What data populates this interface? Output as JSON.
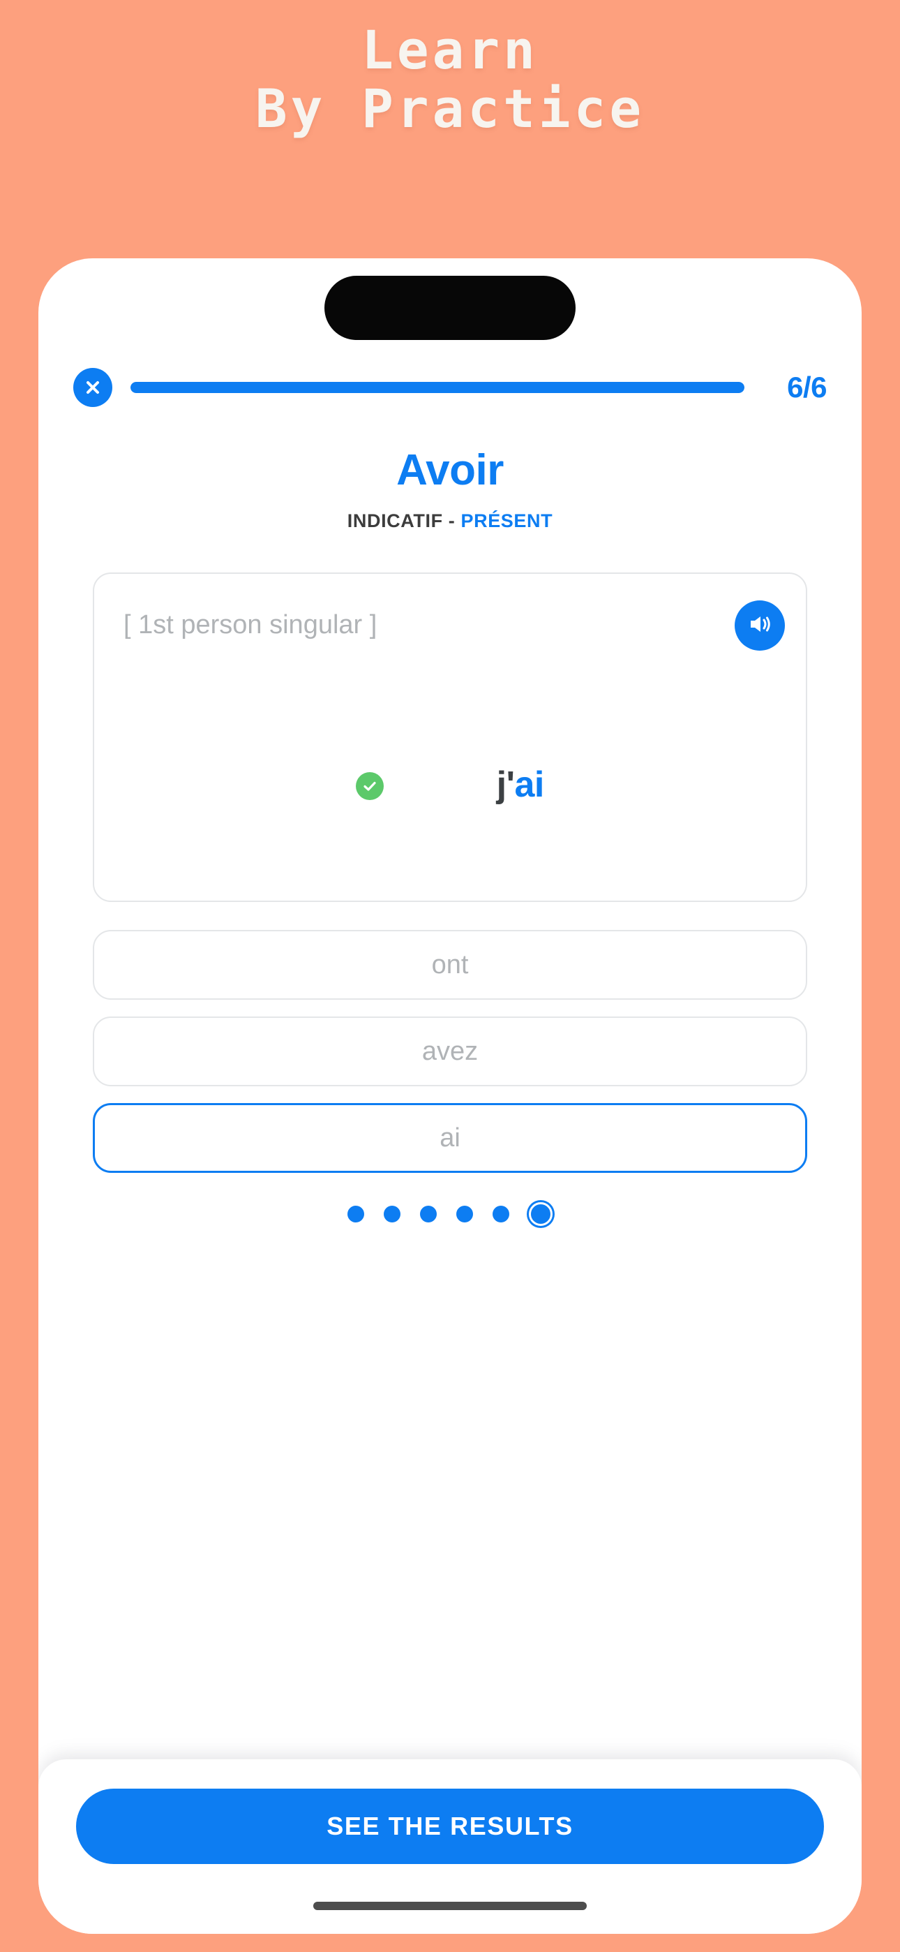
{
  "promo": {
    "line1": "Learn",
    "line2": "By Practice",
    "text_color": "#F7F4EF",
    "background_color": "#FDA07E"
  },
  "theme": {
    "accent": "#0D7DF2",
    "success": "#5CC96A",
    "muted_text": "#B0B3B6",
    "border": "#E4E6E8",
    "dark_text": "#3C4043"
  },
  "phone": {
    "notch": "dynamic-island"
  },
  "topbar": {
    "close_icon": "close-icon",
    "progress": {
      "current": 6,
      "total": 6,
      "percent": 100
    },
    "counter_label": "6/6"
  },
  "exercise": {
    "verb": "Avoir",
    "mood": "INDICATIF",
    "separator": "-",
    "tense": "PRÉSENT",
    "hint": "[ 1st person singular ]",
    "speaker_icon": "speaker-icon",
    "result_icon": "check-circle-icon",
    "answer_pronoun": "j'",
    "answer_ending": "ai",
    "is_correct": true
  },
  "options": [
    {
      "label": "ont",
      "selected": false
    },
    {
      "label": "avez",
      "selected": false
    },
    {
      "label": "ai",
      "selected": true
    }
  ],
  "pagination": {
    "count": 6,
    "current_index": 6
  },
  "footer": {
    "cta_label": "SEE THE RESULTS"
  }
}
